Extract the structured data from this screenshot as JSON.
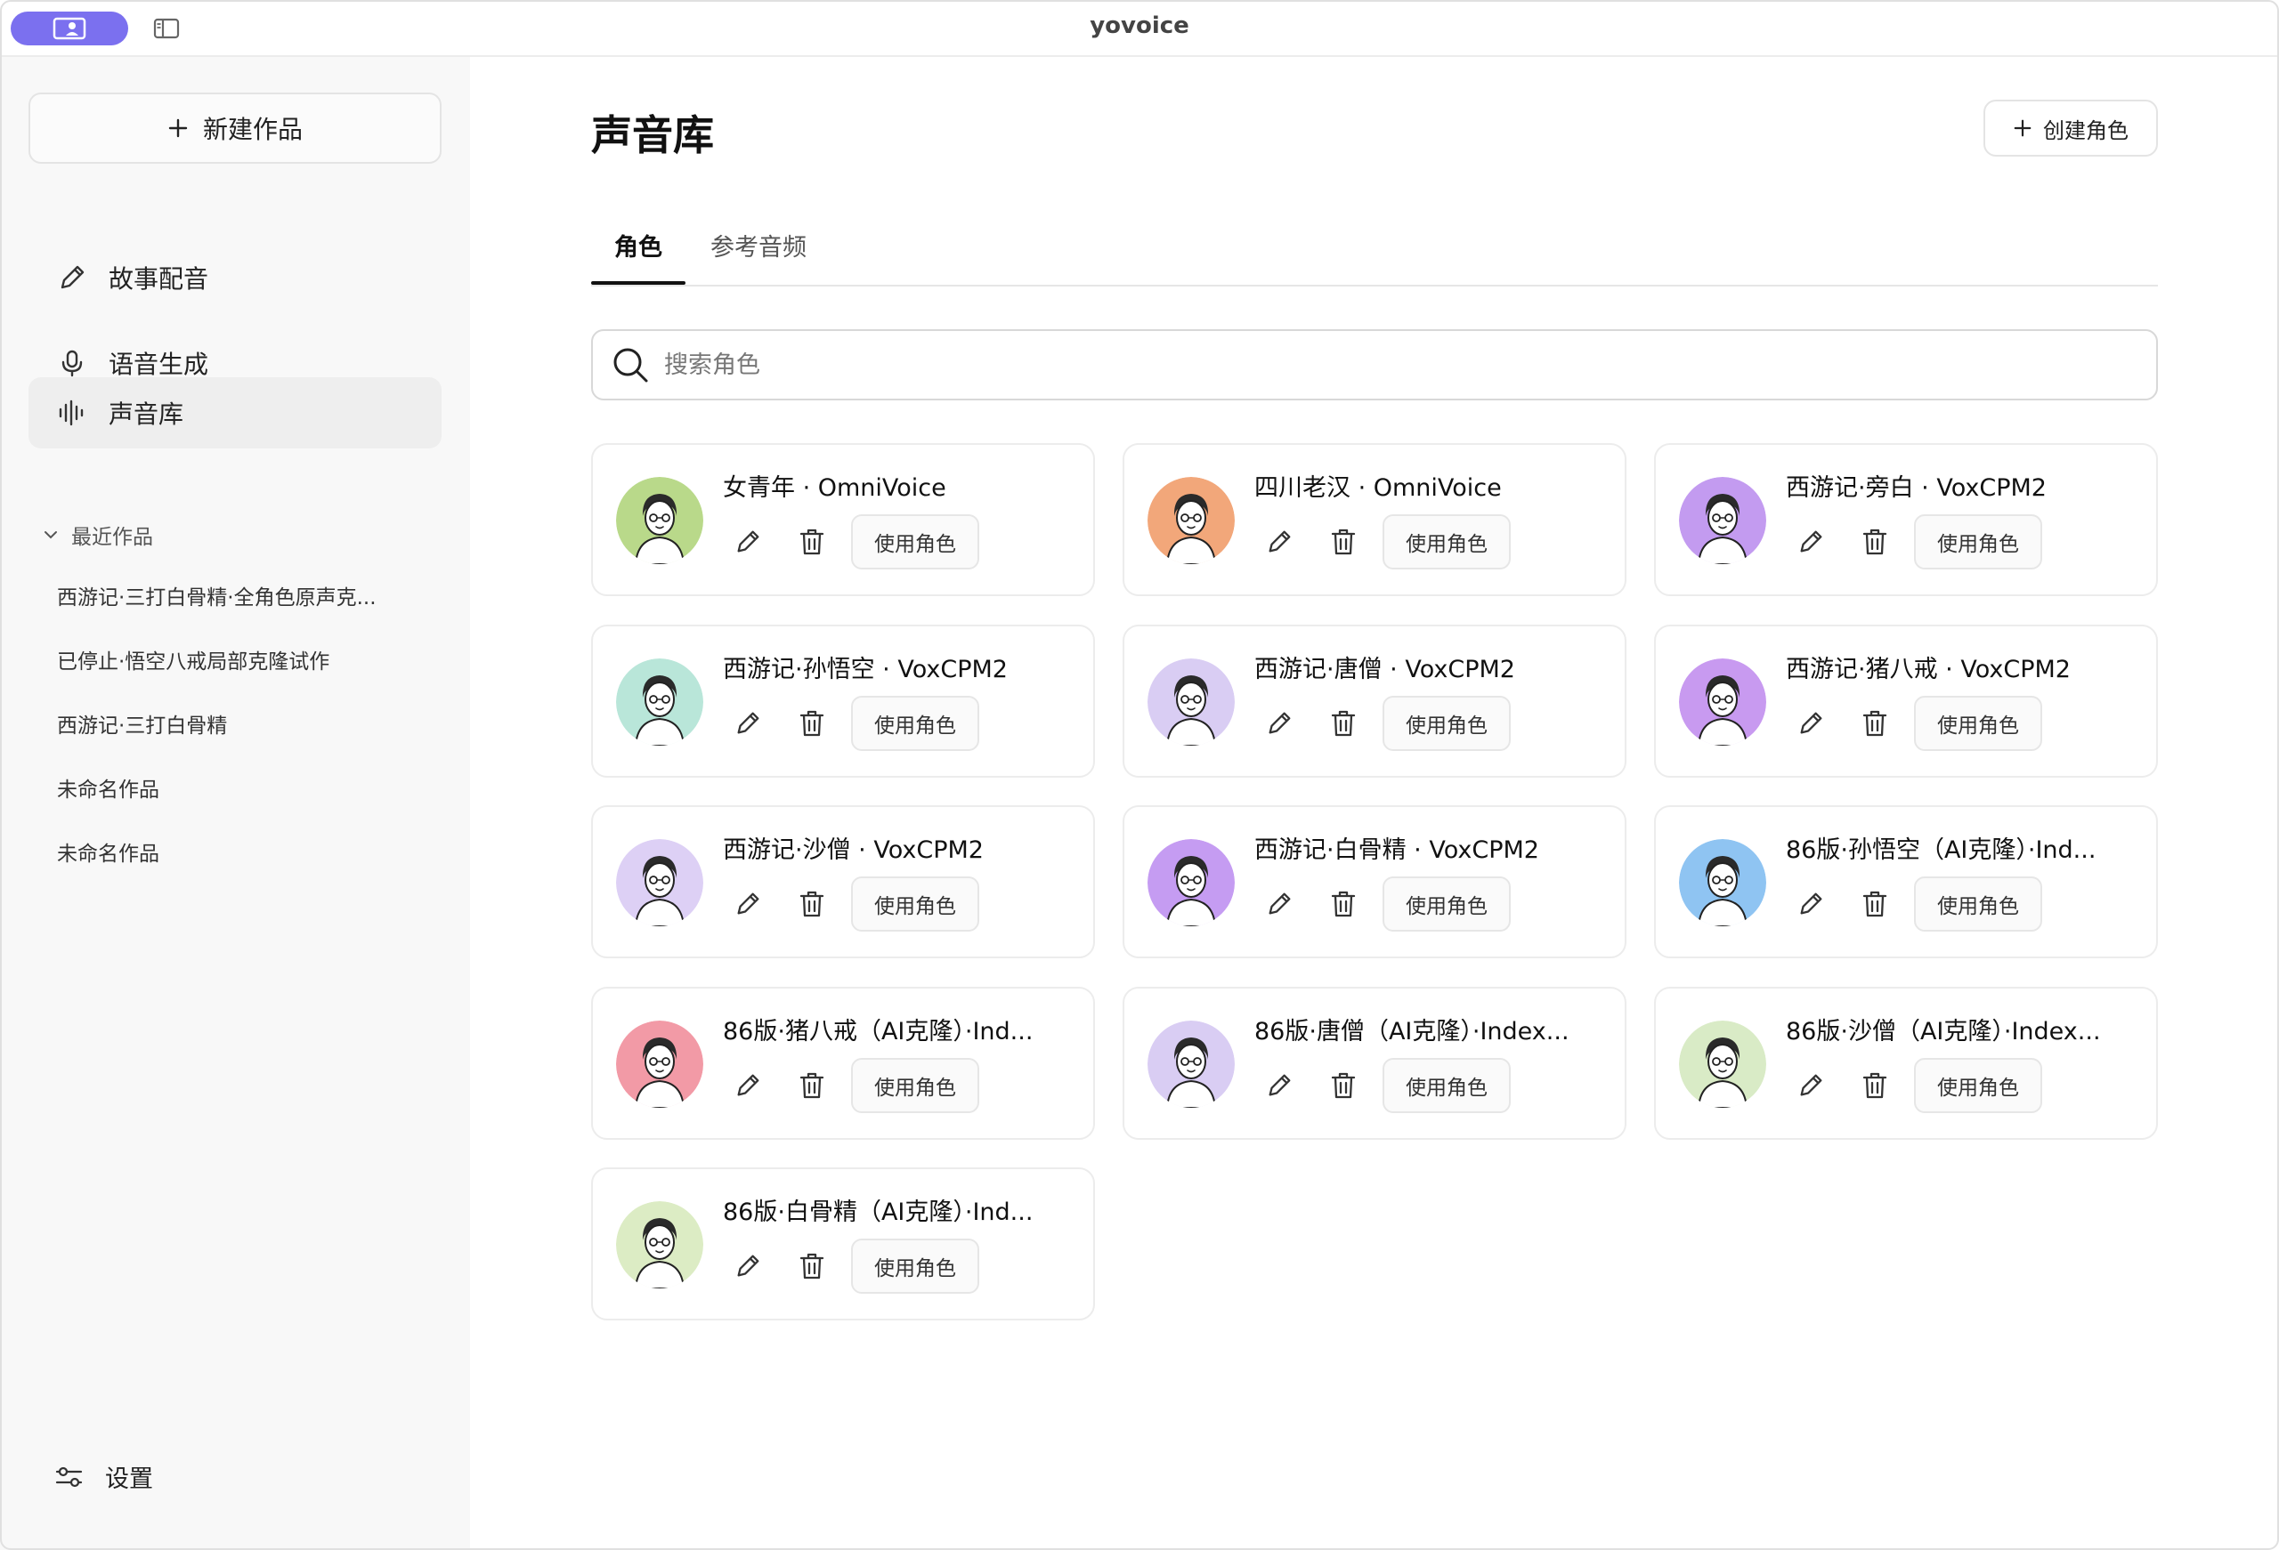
{
  "app": {
    "title": "yovoice"
  },
  "sidebar": {
    "new_work_label": "新建作品",
    "nav": [
      {
        "label": "故事配音",
        "icon": "pencil-icon"
      },
      {
        "label": "语音生成",
        "icon": "microphone-icon"
      },
      {
        "label": "声音库",
        "icon": "waveform-icon",
        "active": true
      }
    ],
    "recent_header": "最近作品",
    "recent": [
      "西游记·三打白骨精·全角色原声克...",
      "已停止·悟空八戒局部克隆试作",
      "西游记·三打白骨精",
      "未命名作品",
      "未命名作品"
    ],
    "settings_label": "设置"
  },
  "main": {
    "title": "声音库",
    "create_label": "创建角色",
    "tabs": [
      {
        "label": "角色",
        "active": true
      },
      {
        "label": "参考音频",
        "active": false
      }
    ],
    "search_placeholder": "搜索角色",
    "use_label": "使用角色"
  },
  "roles": [
    {
      "name": "女青年 · OmniVoice",
      "avatar_bg": "#b9d98a"
    },
    {
      "name": "四川老汉 · OmniVoice",
      "avatar_bg": "#f2a77a"
    },
    {
      "name": "西游记·旁白 · VoxCPM2",
      "avatar_bg": "#c39bf0"
    },
    {
      "name": "西游记·孙悟空 · VoxCPM2",
      "avatar_bg": "#b9e6d9"
    },
    {
      "name": "西游记·唐僧 · VoxCPM2",
      "avatar_bg": "#d9cdf3"
    },
    {
      "name": "西游记·猪八戒 · VoxCPM2",
      "avatar_bg": "#c89af0"
    },
    {
      "name": "西游记·沙僧 · VoxCPM2",
      "avatar_bg": "#ddd0f5"
    },
    {
      "name": "西游记·白骨精 · VoxCPM2",
      "avatar_bg": "#c59cf2"
    },
    {
      "name": "86版·孙悟空（AI克隆）·Ind...",
      "avatar_bg": "#8fc4f2"
    },
    {
      "name": "86版·猪八戒（AI克隆）·Ind...",
      "avatar_bg": "#f29aa6"
    },
    {
      "name": "86版·唐僧（AI克隆）·Index...",
      "avatar_bg": "#d9cdf3"
    },
    {
      "name": "86版·沙僧（AI克隆）·Index...",
      "avatar_bg": "#d9ebc6"
    },
    {
      "name": "86版·白骨精（AI克隆）·Ind...",
      "avatar_bg": "#dcecc4"
    }
  ]
}
